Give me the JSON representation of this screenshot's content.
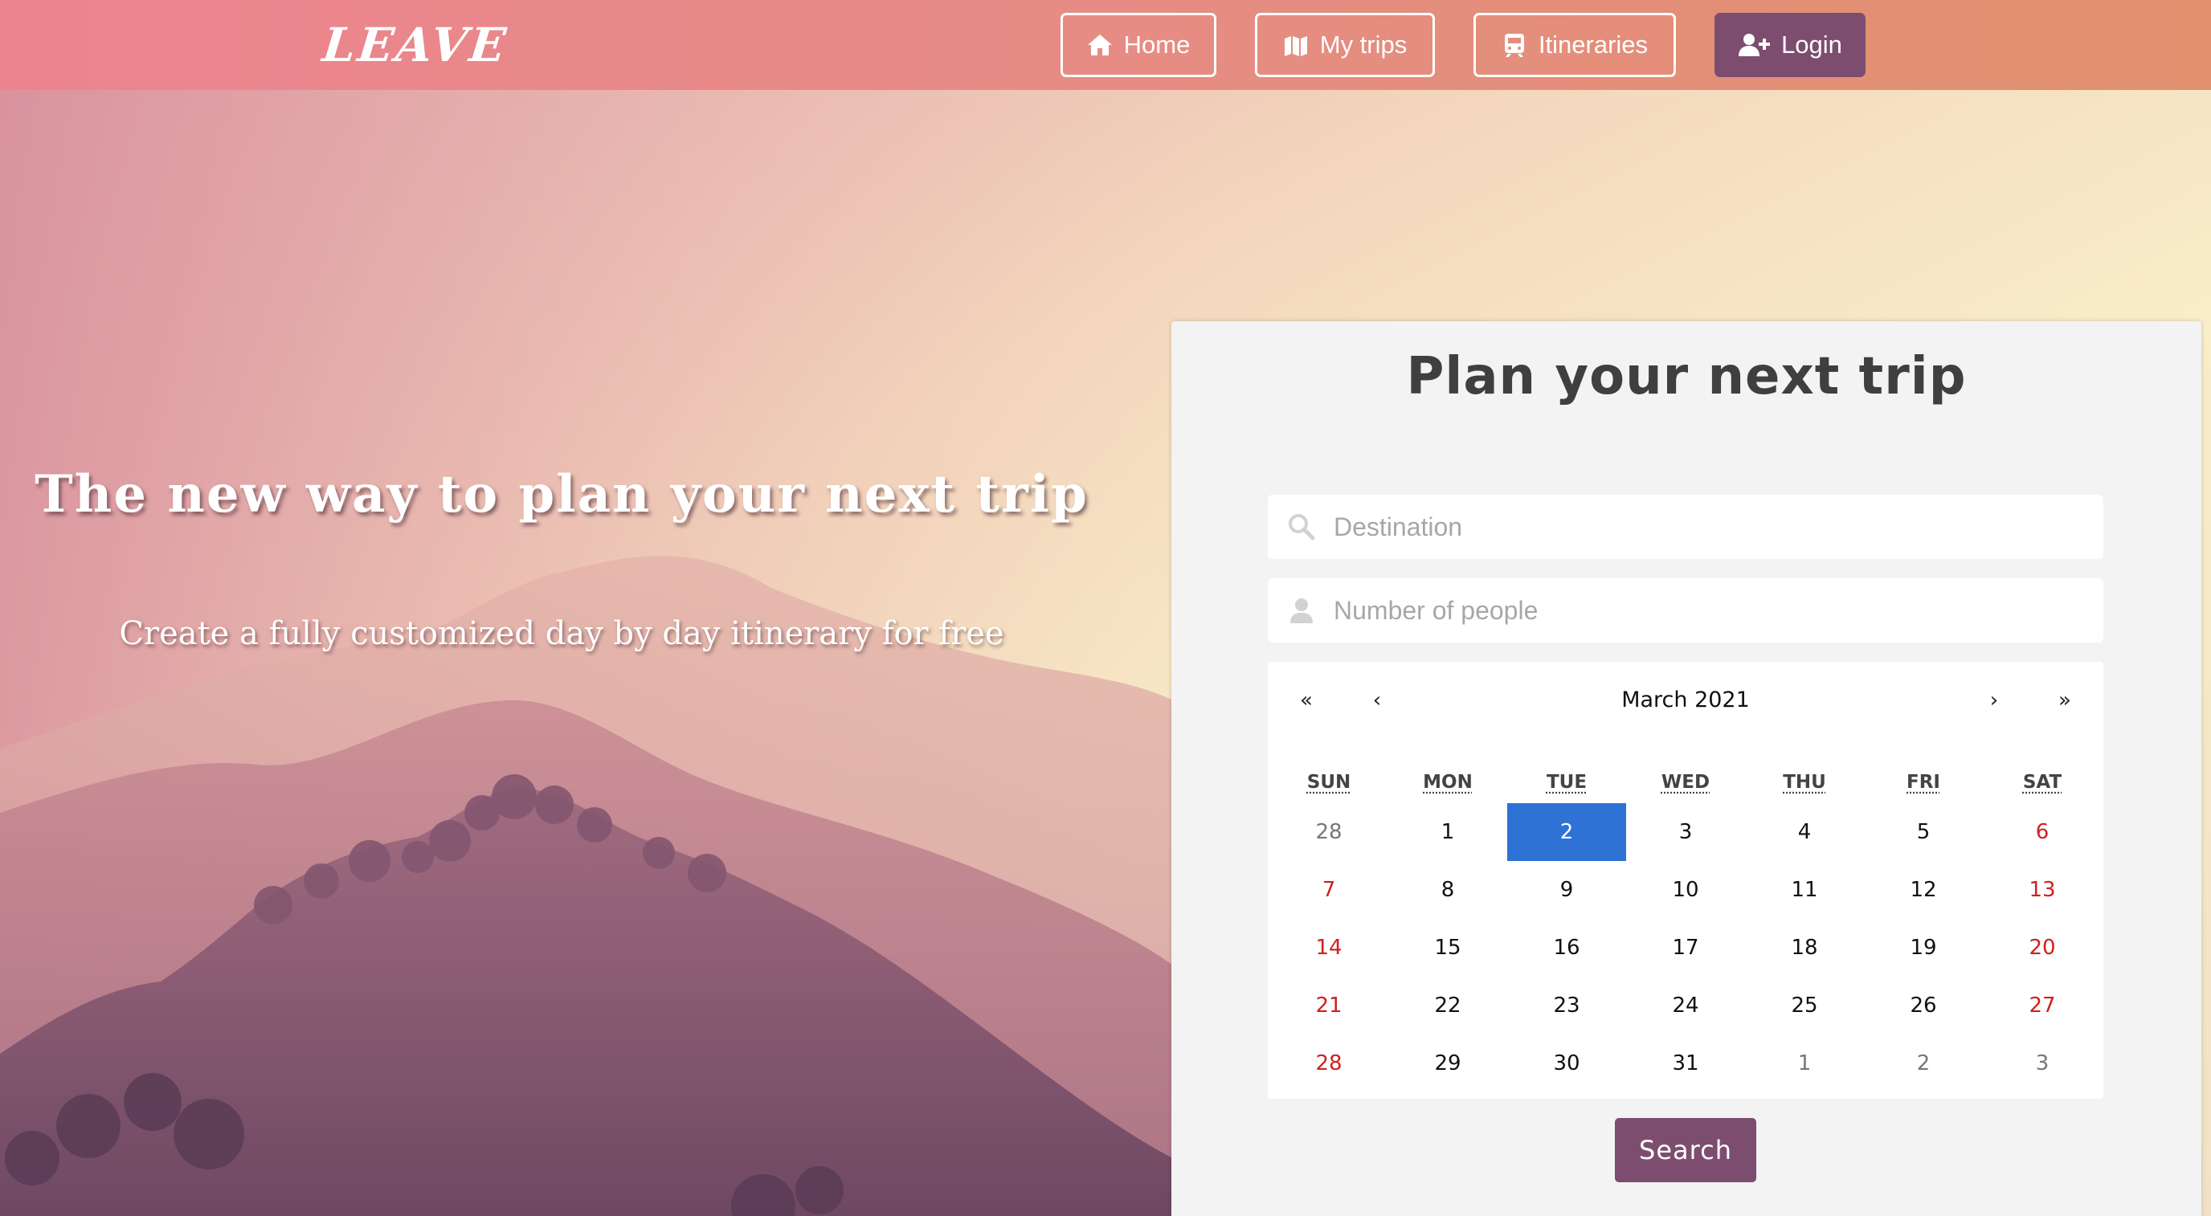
{
  "navbar": {
    "brand": "LEAVE",
    "links": [
      {
        "label": "Home",
        "icon": "home-icon"
      },
      {
        "label": "My trips",
        "icon": "map-icon"
      },
      {
        "label": "Itineraries",
        "icon": "train-icon"
      },
      {
        "label": "Login",
        "icon": "user-plus-icon"
      }
    ]
  },
  "hero": {
    "title": "The new way to plan your next trip",
    "subtitle": "Create a fully customized day by day itinerary for free"
  },
  "planner": {
    "title": "Plan your next trip",
    "destination_placeholder": "Destination",
    "people_placeholder": "Number of people",
    "search_label": "Search"
  },
  "calendar": {
    "nav": {
      "prev_year": "«",
      "prev_month": "‹",
      "next_month": "›",
      "next_year": "»"
    },
    "month_label": "March 2021",
    "weekdays": [
      "SUN",
      "MON",
      "TUE",
      "WED",
      "THU",
      "FRI",
      "SAT"
    ],
    "days": [
      {
        "label": "28",
        "other_month": true
      },
      {
        "label": "1"
      },
      {
        "label": "2",
        "selected": true
      },
      {
        "label": "3"
      },
      {
        "label": "4"
      },
      {
        "label": "5"
      },
      {
        "label": "6"
      },
      {
        "label": "7"
      },
      {
        "label": "8"
      },
      {
        "label": "9"
      },
      {
        "label": "10"
      },
      {
        "label": "11"
      },
      {
        "label": "12"
      },
      {
        "label": "13"
      },
      {
        "label": "14"
      },
      {
        "label": "15"
      },
      {
        "label": "16"
      },
      {
        "label": "17"
      },
      {
        "label": "18"
      },
      {
        "label": "19"
      },
      {
        "label": "20"
      },
      {
        "label": "21"
      },
      {
        "label": "22"
      },
      {
        "label": "23"
      },
      {
        "label": "24"
      },
      {
        "label": "25"
      },
      {
        "label": "26"
      },
      {
        "label": "27"
      },
      {
        "label": "28"
      },
      {
        "label": "29"
      },
      {
        "label": "30"
      },
      {
        "label": "31"
      },
      {
        "label": "1",
        "other_month": true
      },
      {
        "label": "2",
        "other_month": true
      },
      {
        "label": "3",
        "other_month": true
      }
    ]
  },
  "colors": {
    "accent": "#7d4d70",
    "selected_day": "#2e72d6",
    "weekend": "#d0201f"
  }
}
